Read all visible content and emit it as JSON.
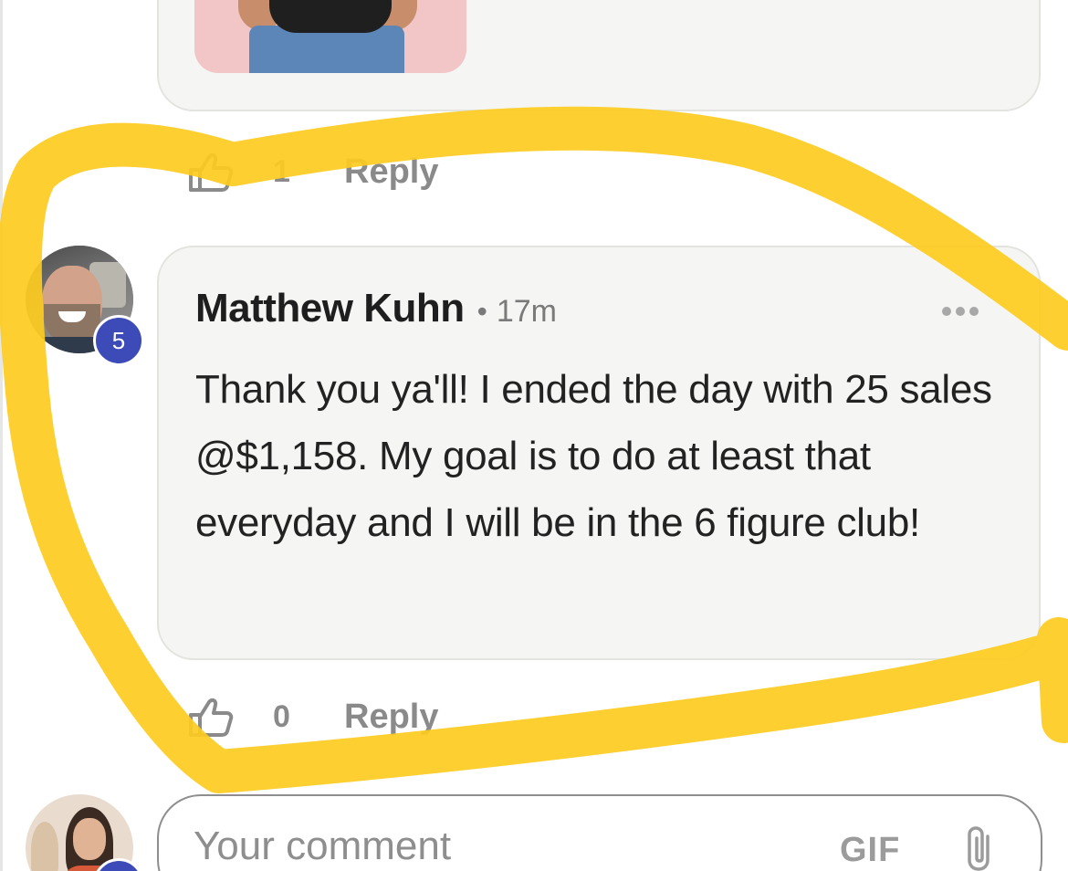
{
  "previous_comment": {
    "like_count": "1",
    "reply_label": "Reply"
  },
  "comment": {
    "author": "Matthew Kuhn",
    "separator": "•",
    "time": "17m",
    "level": "5",
    "text": "Thank you ya'll! I ended the day with 25 sales @$1,158. My goal is to do at least that everyday and I will be in the 6 figure club!",
    "like_count": "0",
    "reply_label": "Reply"
  },
  "compose": {
    "placeholder": "Your comment",
    "gif_label": "GIF"
  },
  "annotation": {
    "highlight_color": "#FDCB1E"
  },
  "icons": {
    "like": "thumbs-up-icon",
    "more": "more-dots-icon",
    "attach": "paperclip-icon"
  }
}
